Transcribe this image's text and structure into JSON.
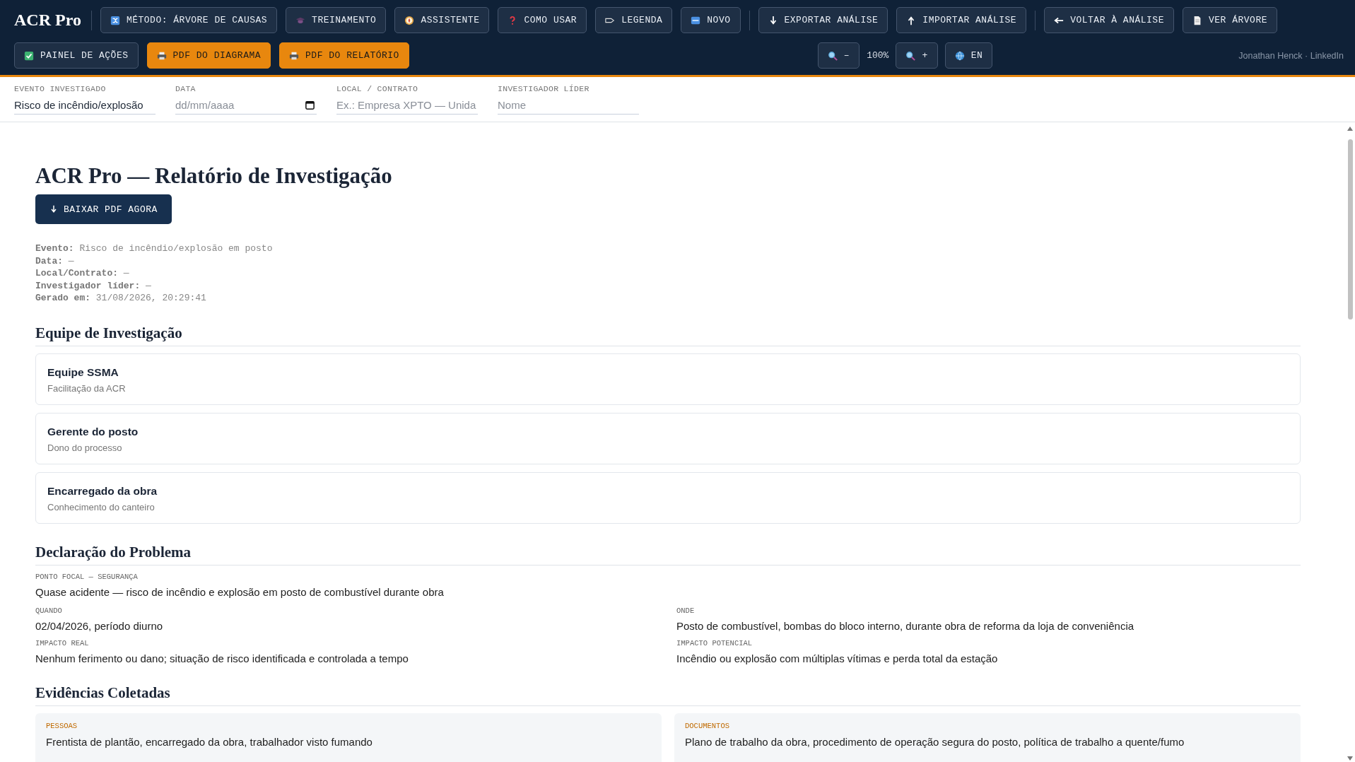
{
  "header": {
    "logo": "ACR Pro",
    "toolbar_groups": [
      [
        {
          "label": "MÉTODO: ÁRVORE DE CAUSAS"
        },
        {
          "label": "TREINAMENTO"
        },
        {
          "label": "ASSISTENTE"
        },
        {
          "label": "COMO USAR"
        },
        {
          "label": "LEGENDA"
        },
        {
          "label": "NOVO"
        }
      ],
      [
        {
          "label": "EXPORTAR ANÁLISE"
        },
        {
          "label": "IMPORTAR ANÁLISE"
        }
      ],
      [
        {
          "label": "VOLTAR À ANÁLISE"
        },
        {
          "label": "VER ÁRVORE"
        }
      ]
    ],
    "actions": [
      {
        "label": "PAINEL DE AÇÕES",
        "kind": "default"
      },
      {
        "label": "PDF DO DIAGRAMA",
        "kind": "accent"
      },
      {
        "label": "PDF DO RELATÓRIO",
        "kind": "accent"
      }
    ],
    "zoom": {
      "out": "–",
      "reading": "100%",
      "in": "+"
    },
    "language": "EN",
    "credit": "Jonathan Henck · LinkedIn"
  },
  "fields": [
    {
      "label": "EVENTO INVESTIGADO",
      "value": "Risco de incêndio/explosão",
      "kind": "text"
    },
    {
      "label": "DATA",
      "placeholder": "dd/mm/aaaa",
      "kind": "date"
    },
    {
      "label": "LOCAL / CONTRATO",
      "placeholder": "Ex.: Empresa XPTO — Unida",
      "kind": "text"
    },
    {
      "label": "INVESTIGADOR LÍDER",
      "placeholder": "Nome",
      "kind": "text"
    }
  ],
  "report": {
    "title": "ACR Pro — Relatório de Investigação",
    "download": "BAIXAR PDF AGORA",
    "meta": [
      "**Evento:** Risco de incêndio/explosão em posto",
      "**Data:** —",
      "**Local/Contrato:** —",
      "**Investigador líder:** —",
      "**Gerado em:** 31/08/2026, 20:29:41"
    ],
    "team": {
      "heading": "Equipe de Investigação",
      "members": [
        {
          "name": "Equipe SSMA",
          "role": "Facilitação da ACR"
        },
        {
          "name": "Gerente do posto",
          "role": "Dono do processo"
        },
        {
          "name": "Encarregado da obra",
          "role": "Conhecimento do canteiro"
        }
      ]
    },
    "problem": {
      "heading": "Declaração do Problema",
      "focal_label": "PONTO FOCAL — SEGURANÇA",
      "focal": "Quase acidente — risco de incêndio e explosão em posto de combustível durante obra",
      "items": [
        {
          "label": "QUANDO",
          "text": "02/04/2026, período diurno"
        },
        {
          "label": "ONDE",
          "text": "Posto de combustível, bombas do bloco interno, durante obra de reforma da loja de conveniência"
        },
        {
          "label": "IMPACTO REAL",
          "text": "Nenhum ferimento ou dano; situação de risco identificada e controlada a tempo"
        },
        {
          "label": "IMPACTO POTENCIAL",
          "text": "Incêndio ou explosão com múltiplas vítimas e perda total da estação"
        }
      ]
    },
    "evidence": {
      "heading": "Evidências Coletadas",
      "items": [
        {
          "label": "PESSOAS",
          "text": "Frentista de plantão, encarregado da obra, trabalhador visto fumando"
        },
        {
          "label": "DOCUMENTOS",
          "text": "Plano de trabalho da obra, procedimento de operação segura do posto, política de trabalho a quente/fumo"
        }
      ]
    }
  }
}
